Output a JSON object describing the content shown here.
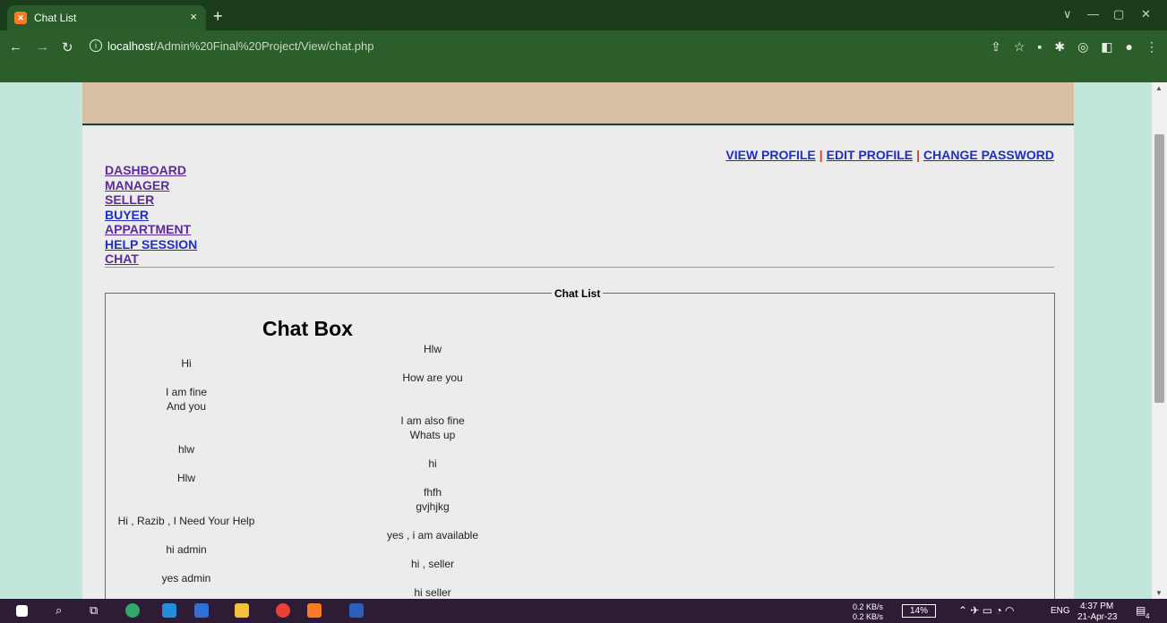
{
  "browser": {
    "tab_title": "Chat List",
    "tab_close": "×",
    "new_tab": "+",
    "url_host": "localhost",
    "url_path": "/Admin%20Final%20Project/View/chat.php",
    "window_controls": [
      "∨",
      "—",
      "▢",
      "✕"
    ],
    "toolbar_icons": [
      "share-icon",
      "star-icon",
      "puzzle-icon",
      "extension-icon",
      "sidepanel-icon",
      "profile-icon",
      "menu-icon"
    ]
  },
  "header_links": {
    "view_profile": "VIEW PROFILE",
    "edit_profile": "EDIT PROFILE",
    "change_password": "CHANGE PASSWORD",
    "separator": "|"
  },
  "menu": {
    "items": [
      "DASHBOARD",
      "MANAGER",
      "SELLER",
      "BUYER",
      "APPARTMENT",
      "HELP SESSION",
      "CHAT"
    ]
  },
  "chat": {
    "legend": "Chat List",
    "title": "Chat Box",
    "left_messages": [
      "Hi",
      "I am fine",
      "And you",
      "hlw",
      "Hlw",
      "Hi , Razib , I Need Your Help",
      "hi admin",
      "yes admin"
    ],
    "right_messages": [
      "Hlw",
      "How are you",
      "I am also fine",
      "Whats up",
      "hi",
      "fhfh",
      "gvjhjkg",
      "yes , i am available",
      "hi , seller",
      "hi seller"
    ]
  },
  "taskbar": {
    "net_down": "0.2 KB/s",
    "net_up": "0.2 KB/s",
    "battery": "14%",
    "lang": "ENG",
    "time": "4:37 PM",
    "date": "21-Apr-23",
    "notifications": "4"
  },
  "colors": {
    "link": "#1f2ec8",
    "visited_link": "#5b2b9c",
    "banner": "#d7c0a1",
    "page_bg": "#c3e6db"
  }
}
